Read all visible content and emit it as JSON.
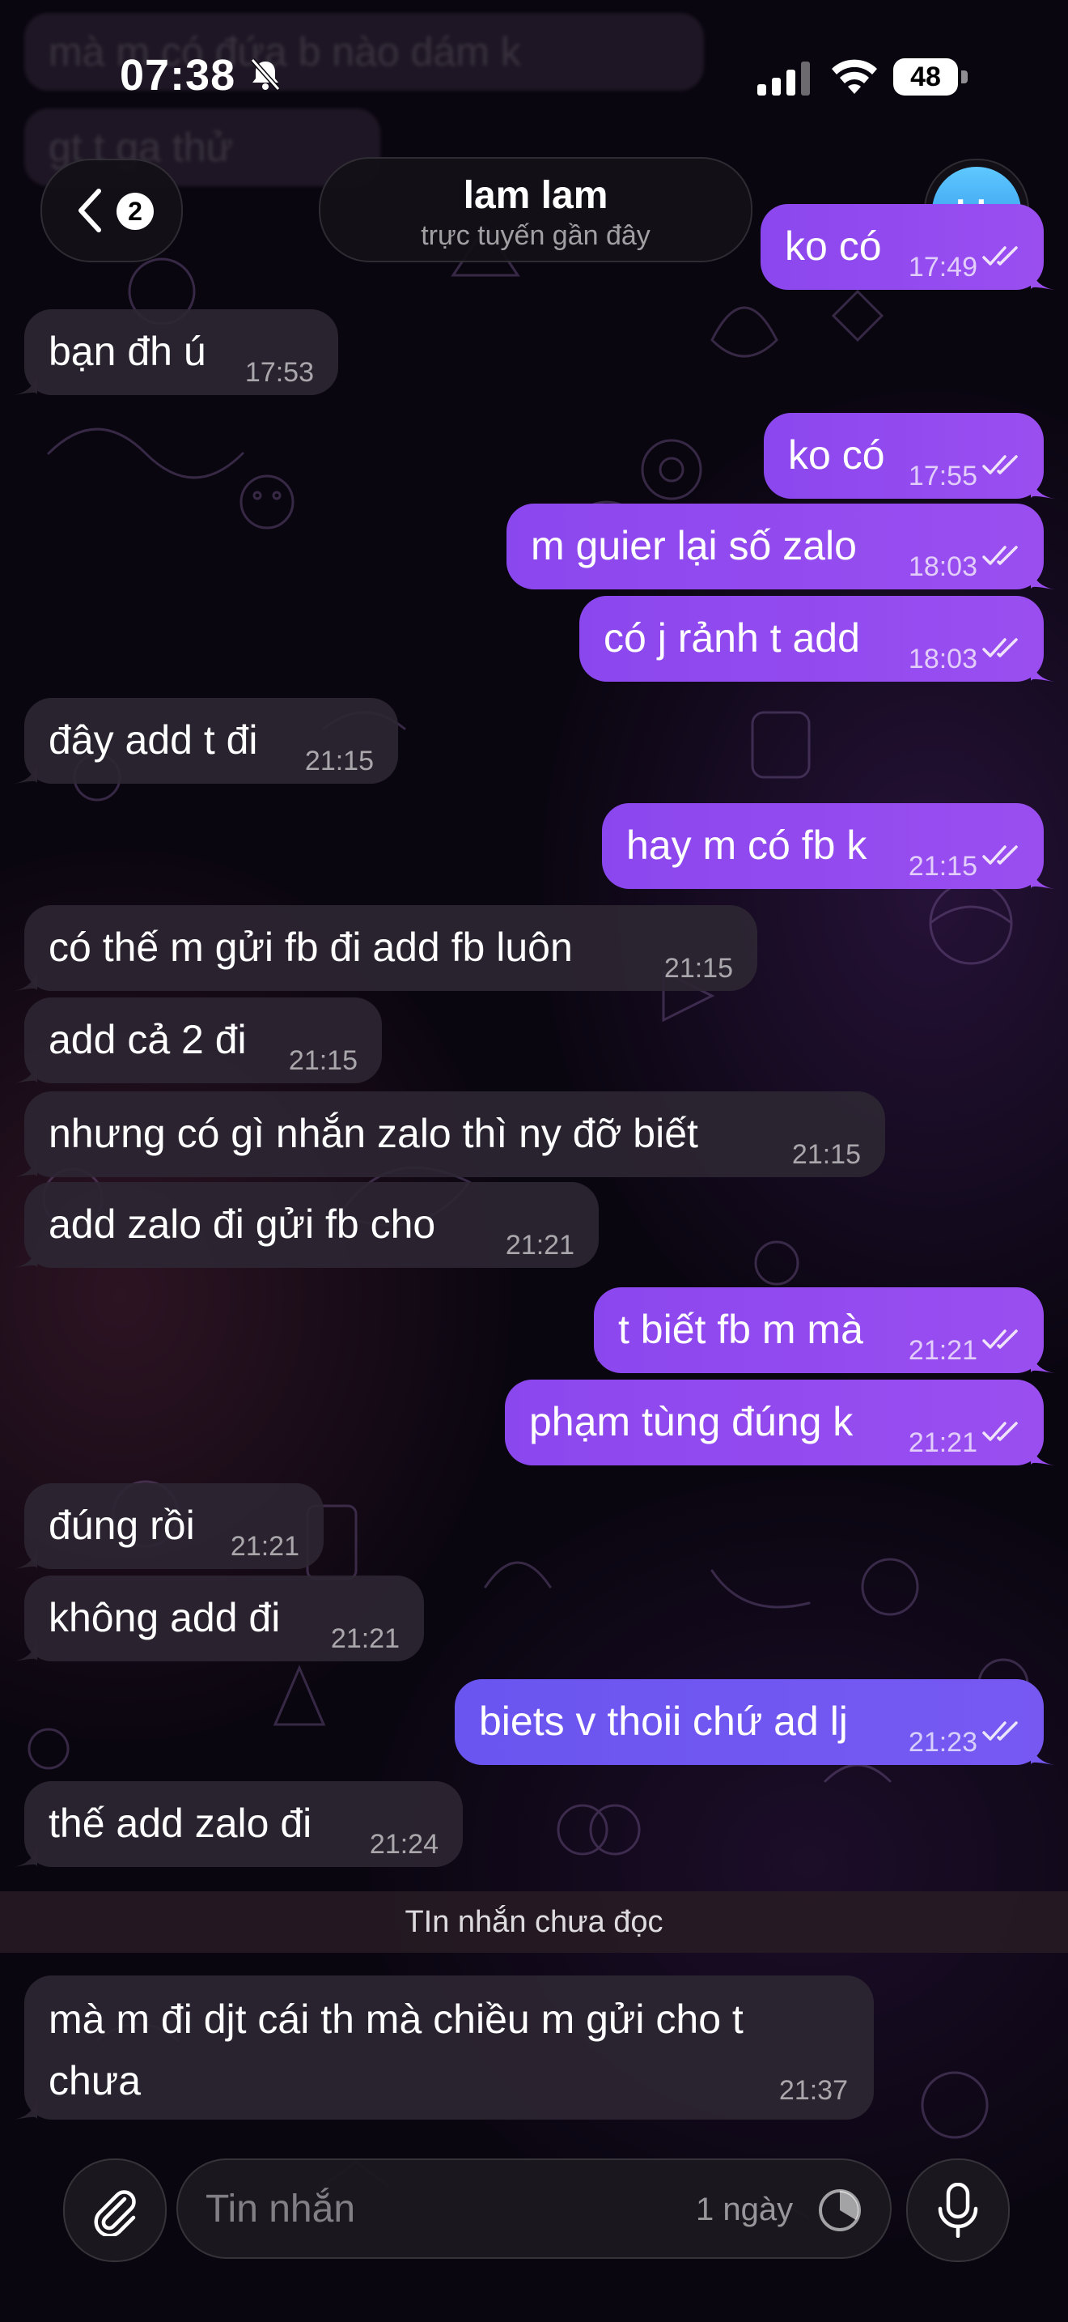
{
  "status_bar": {
    "time": "07:38",
    "battery": "48"
  },
  "background_messages": [
    {
      "text": "mà m có đứa b nào dám k"
    },
    {
      "text": "gt t ga thử"
    }
  ],
  "header": {
    "back_count": "2",
    "name": "lam lam",
    "subtitle": "trực tuyến gần đây",
    "avatar_initials": "LL",
    "avatar_color": "#3aa6f0"
  },
  "messages": [
    {
      "dir": "out",
      "text": "ko có",
      "time": "17:49"
    },
    {
      "dir": "in",
      "text": "bạn đh ú",
      "time": "17:53"
    },
    {
      "dir": "out",
      "text": "ko có",
      "time": "17:55"
    },
    {
      "dir": "out",
      "text": "m guier lại số zalo",
      "time": "18:03"
    },
    {
      "dir": "out",
      "text": "có j rảnh t add",
      "time": "18:03"
    },
    {
      "dir": "in",
      "text": "đây add t đi",
      "time": "21:15"
    },
    {
      "dir": "out",
      "text": "hay m có fb k",
      "time": "21:15"
    },
    {
      "dir": "in",
      "text": "có thế m gửi fb đi add fb luôn",
      "time": "21:15"
    },
    {
      "dir": "in",
      "text": "add cả 2 đi",
      "time": "21:15"
    },
    {
      "dir": "in",
      "text": "nhưng có gì nhắn zalo thì ny đỡ biết",
      "time": "21:15"
    },
    {
      "dir": "in",
      "text": "add zalo đi gửi fb cho",
      "time": "21:21"
    },
    {
      "dir": "out",
      "text": "t biết fb m mà",
      "time": "21:21"
    },
    {
      "dir": "out",
      "text": "phạm tùng đúng k",
      "time": "21:21"
    },
    {
      "dir": "in",
      "text": "đúng rồi",
      "time": "21:21"
    },
    {
      "dir": "in",
      "text": "không add đi",
      "time": "21:21"
    },
    {
      "dir": "out",
      "text": "biets v thoii chứ ad lj",
      "time": "21:23"
    },
    {
      "dir": "in",
      "text": "thế add zalo đi",
      "time": "21:24"
    }
  ],
  "unread_label": "TIn nhắn chưa đọc",
  "last_message": {
    "line1": "mà m đi djt cái th mà chiều m gửi cho t",
    "line2": "chưa",
    "time": "21:37"
  },
  "composer": {
    "placeholder": "Tin nhắn",
    "timer_label": "1 ngày"
  },
  "colors": {
    "outgoing": "#9a4ef0",
    "outgoing_alt": "#7759f2",
    "incoming": "#2c2632",
    "background": "#0b0710"
  }
}
